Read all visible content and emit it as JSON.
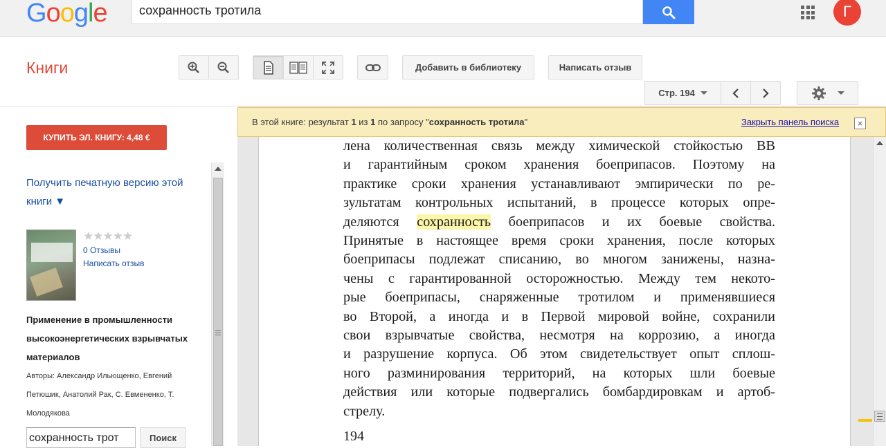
{
  "header": {
    "logo": "Google",
    "logo_colors": [
      "#4285f4",
      "#ea4335",
      "#fbbc05",
      "#4285f4",
      "#34a853",
      "#ea4335"
    ],
    "search_value": "сохранность тротила",
    "avatar_letter": "Г",
    "apps_icon": "apps-grid-icon",
    "search_icon": "magnifier-icon"
  },
  "toolbar": {
    "section_title": "Книги",
    "zoom_in_icon": "zoom-in-icon",
    "zoom_out_icon": "zoom-out-icon",
    "view_single_icon": "single-page-icon",
    "view_double_icon": "two-page-icon",
    "fullscreen_icon": "fullscreen-icon",
    "link_icon": "link-icon",
    "add_library_label": "Добавить в библиотеку",
    "write_review_label": "Написать отзыв",
    "page_label": "Стр. 194",
    "settings_icon": "gear-icon"
  },
  "sidebar": {
    "buy_label": "КУПИТЬ ЭЛ. КНИГУ: 4,48 €",
    "print_link": "Получить печатную версию этой книги ▼",
    "rating_stars": "★★★★★",
    "reviews_count": "0 Отзывы",
    "write_review": "Написать отзыв",
    "book_title": "Применение в промышленности высокоэнергетических взрывчатых материалов",
    "authors": "Авторы: Александр Ильющенко, Евгений Петюшик, Анатолий Рак, С. Евмененко, Т. Молодякова",
    "inbook_search_value": "сохранность трот",
    "inbook_search_button": "Поиск"
  },
  "results_bar": {
    "prefix": "В этой книге: результат ",
    "current": "1",
    "of": " из ",
    "total": "1",
    "query_prefix": " по запросу \"",
    "query": "сохранность тротила",
    "query_suffix": "\"",
    "close_label": "Закрыть панель поиска",
    "close_icon": "×"
  },
  "page": {
    "lines_before": [
      "лена количественная связь между химической стойкостью ВВ",
      "и гарантийным сроком хранения боеприпасов. Поэтому на",
      "практике сроки хранения устанавливают эмпирически по ре-",
      "зультатам контрольных испытаний, в процессе которых опре-"
    ],
    "hl_line_start": "деляются ",
    "hl_word": "сохранность",
    "hl_line_end": " боеприпасов и их боевые свойства.",
    "lines_after": [
      "Принятые в настоящее время сроки хранения, после которых",
      "боеприпасы подлежат списанию, во многом занижены, назна-",
      "чены с гарантированной осторожностью. Между тем некото-",
      "рые боеприпасы, снаряженные тротилом и применявшиеся",
      "во Второй, а иногда и в Первой мировой войне, сохранили",
      "свои взрывчатые свойства, несмотря на коррозию, а иногда",
      "и разрушение корпуса. Об этом свидетельствует опыт сплош-",
      "ного разминирования территорий, на которых шли боевые",
      "действия или которые подвергались бомбардировкам и артоб-",
      "стрелу."
    ],
    "page_number": "194"
  }
}
